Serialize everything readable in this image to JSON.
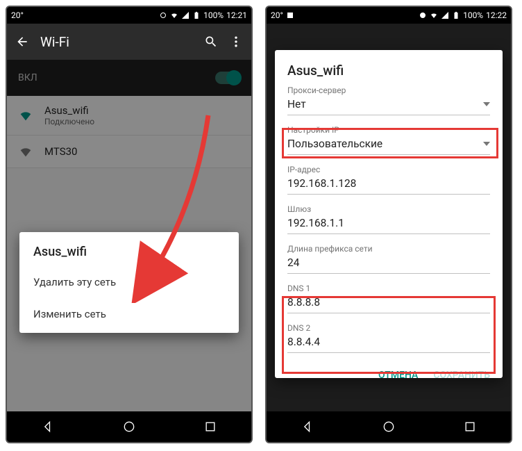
{
  "left": {
    "status": {
      "temp": "20°",
      "battery": "100%",
      "time": "12:21"
    },
    "appbar_title": "Wi-Fi",
    "toggle_label": "ВКЛ",
    "networks": [
      {
        "name": "Asus_wifi",
        "sub": "Подключено"
      },
      {
        "name": "MTS30",
        "sub": ""
      }
    ],
    "popup": {
      "title": "Asus_wifi",
      "items": [
        "Удалить эту сеть",
        "Изменить сеть"
      ]
    }
  },
  "right": {
    "status": {
      "temp": "20°",
      "battery": "100%",
      "time": "12:22"
    },
    "dialog": {
      "title": "Asus_wifi",
      "proxy_label": "Прокси-сервер",
      "proxy_value": "Нет",
      "ip_settings_label": "Настройки IP",
      "ip_settings_value": "Пользовательские",
      "ip_label": "IP-адрес",
      "ip_value": "192.168.1.128",
      "gateway_label": "Шлюз",
      "gateway_value": "192.168.1.1",
      "prefix_label": "Длина префикса сети",
      "prefix_value": "24",
      "dns1_label": "DNS 1",
      "dns1_value": "8.8.8.8",
      "dns2_label": "DNS 2",
      "dns2_value": "8.8.4.4",
      "cancel": "ОТМЕНА",
      "save": "СОХРАНИТЬ"
    }
  }
}
